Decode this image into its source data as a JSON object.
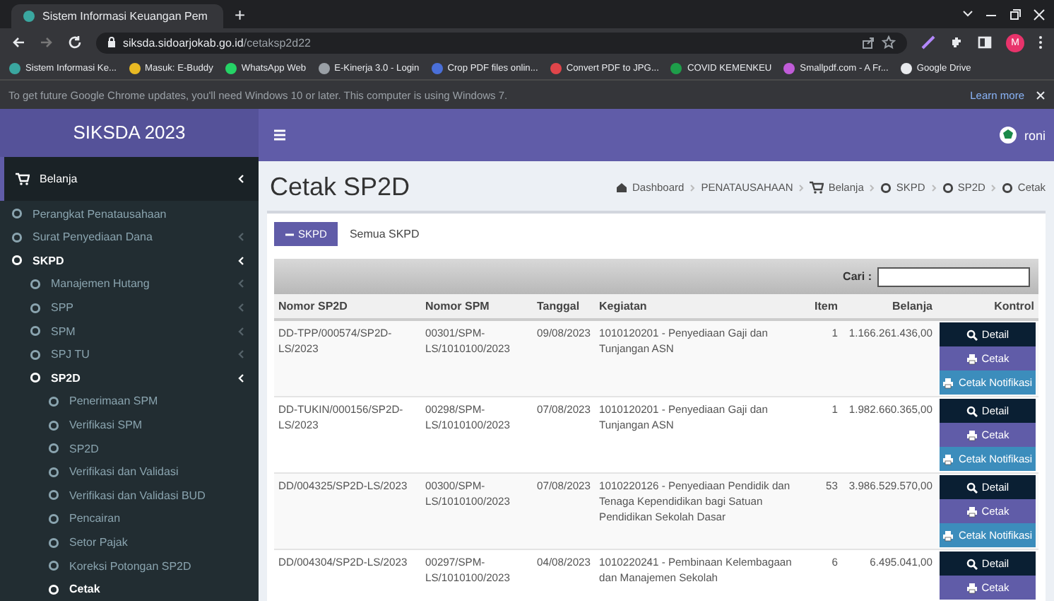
{
  "browser": {
    "tab_title": "Sistem Informasi Keuangan Pem",
    "new_tab": "+",
    "url_host": "siksda.sidoarjokab.go.id",
    "url_path": "/cetaksp2d22",
    "profile_initial": "M",
    "bookmarks": [
      {
        "label": "Sistem Informasi Ke...",
        "color": "#3aa7a0"
      },
      {
        "label": "Masuk: E-Buddy",
        "color": "#e8b923"
      },
      {
        "label": "WhatsApp Web",
        "color": "#25d366"
      },
      {
        "label": "E-Kinerja 3.0 - Login",
        "color": "#9aa0a6"
      },
      {
        "label": "Crop PDF files onlin...",
        "color": "#4a6fd8"
      },
      {
        "label": "Convert PDF to JPG...",
        "color": "#e0454a"
      },
      {
        "label": "COVID KEMENKEU",
        "color": "#1e9e4a"
      },
      {
        "label": "Smallpdf.com - A Fr...",
        "color": "#c05cd8"
      },
      {
        "label": "Google Drive",
        "color": "#e8eaed"
      }
    ],
    "notice": "To get future Google Chrome updates, you'll need Windows 10 or later. This computer is using Windows 7.",
    "learn_more": "Learn more"
  },
  "app": {
    "brand": "SIKSDA 2023",
    "user": "roni"
  },
  "sidebar": {
    "items": [
      {
        "label": "Belanja",
        "expanded": true,
        "children": [
          {
            "label": "Perangkat Penatausahaan",
            "selected": false
          },
          {
            "label": "Surat Penyediaan Dana",
            "expanded": false
          },
          {
            "label": "SKPD",
            "expanded": true,
            "children": [
              {
                "label": "Manajemen Hutang",
                "expanded": false
              },
              {
                "label": "SPP",
                "expanded": false
              },
              {
                "label": "SPM",
                "expanded": false
              },
              {
                "label": "SPJ TU",
                "expanded": false
              },
              {
                "label": "SP2D",
                "expanded": true,
                "children": [
                  {
                    "label": "Penerimaan SPM",
                    "selected": false
                  },
                  {
                    "label": "Verifikasi SPM",
                    "selected": false
                  },
                  {
                    "label": "SP2D",
                    "selected": false
                  },
                  {
                    "label": "Verifikasi dan Validasi",
                    "selected": false
                  },
                  {
                    "label": "Verifikasi dan Validasi BUD",
                    "selected": false
                  },
                  {
                    "label": "Pencairan",
                    "selected": false
                  },
                  {
                    "label": "Setor Pajak",
                    "selected": false
                  },
                  {
                    "label": "Koreksi Potongan SP2D",
                    "selected": false
                  },
                  {
                    "label": "Cetak",
                    "selected": true
                  }
                ]
              }
            ]
          }
        ]
      }
    ]
  },
  "page": {
    "title": "Cetak SP2D",
    "breadcrumb": [
      {
        "label": "Dashboard",
        "kind": "home"
      },
      {
        "label": "PENATAUSAHAAN",
        "kind": "text"
      },
      {
        "label": "Belanja",
        "kind": "cart"
      },
      {
        "label": "SKPD",
        "kind": "circle"
      },
      {
        "label": "SP2D",
        "kind": "circle"
      },
      {
        "label": "Cetak",
        "kind": "circle"
      }
    ],
    "skpd_button": "SKPD",
    "skpd_label": "Semua SKPD",
    "search_label": "Cari :"
  },
  "table": {
    "columns": [
      "Nomor SP2D",
      "Nomor SPM",
      "Tanggal",
      "Kegiatan",
      "Item",
      "Belanja",
      "Kontrol"
    ],
    "rows": [
      {
        "cells": [
          "DD-TPP/000574/SP2D-LS/2023",
          "00301/SPM-LS/1010100/2023",
          "09/08/2023",
          "1010120201 - Penyediaan Gaji dan Tunjangan ASN",
          "1",
          "1.166.261.436,00"
        ],
        "actions": [
          {
            "label": "Detail",
            "kind": "detail"
          },
          {
            "label": "Cetak",
            "kind": "print"
          },
          {
            "label": "Cetak Notifikasi",
            "kind": "notify"
          }
        ]
      },
      {
        "cells": [
          "DD-TUKIN/000156/SP2D-LS/2023",
          "00298/SPM-LS/1010100/2023",
          "07/08/2023",
          "1010120201 - Penyediaan Gaji dan Tunjangan ASN",
          "1",
          "1.982.660.365,00"
        ],
        "actions": [
          {
            "label": "Detail",
            "kind": "detail"
          },
          {
            "label": "Cetak",
            "kind": "print"
          },
          {
            "label": "Cetak Notifikasi",
            "kind": "notify"
          }
        ]
      },
      {
        "cells": [
          "DD/004325/SP2D-LS/2023",
          "00300/SPM-LS/1010100/2023",
          "07/08/2023",
          "1010220126 - Penyediaan Pendidik dan Tenaga Kependidikan bagi Satuan Pendidikan Sekolah Dasar",
          "53",
          "3.986.529.570,00"
        ],
        "actions": [
          {
            "label": "Detail",
            "kind": "detail"
          },
          {
            "label": "Cetak",
            "kind": "print"
          },
          {
            "label": "Cetak Notifikasi",
            "kind": "notify"
          }
        ]
      },
      {
        "cells": [
          "DD/004304/SP2D-LS/2023",
          "00297/SPM-LS/1010100/2023",
          "04/08/2023",
          "1010220241 - Pembinaan Kelembagaan dan Manajemen Sekolah",
          "6",
          "6.495.041,00"
        ],
        "actions": [
          {
            "label": "Detail",
            "kind": "detail"
          },
          {
            "label": "Cetak",
            "kind": "print"
          }
        ]
      }
    ]
  }
}
